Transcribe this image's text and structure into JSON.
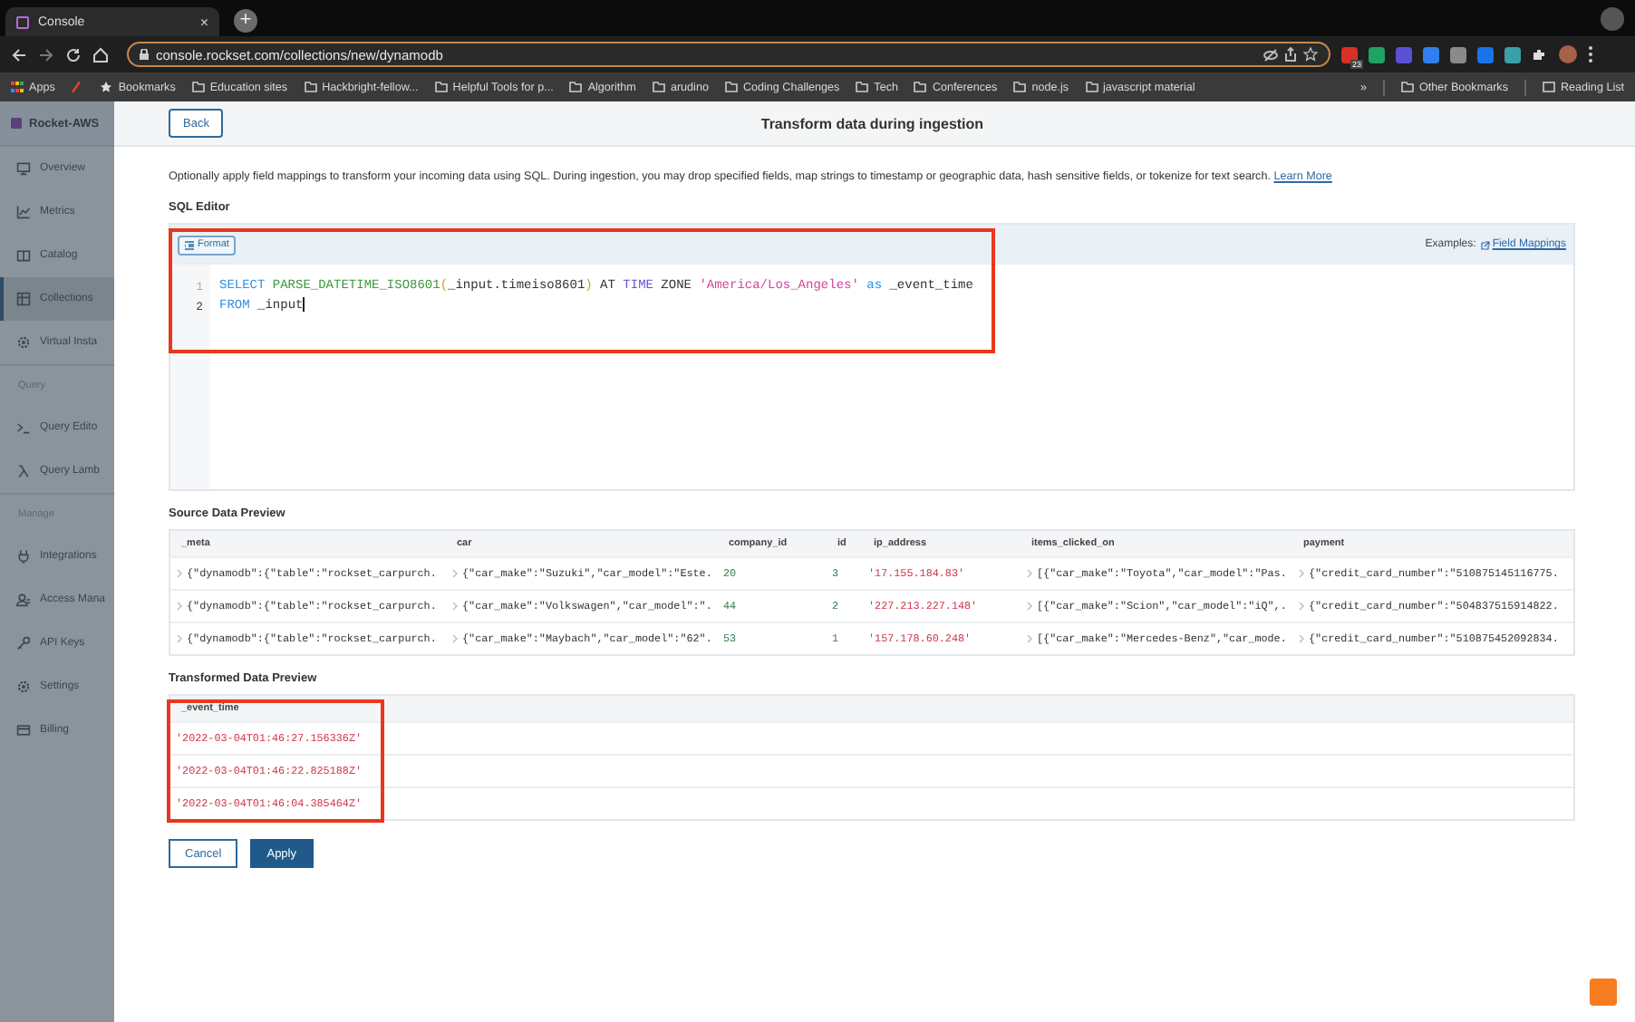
{
  "browser": {
    "tab": {
      "title": "Console",
      "close": "×",
      "selected": true
    },
    "new_tab": "+",
    "url": "console.rockset.com/collections/new/dynamodb",
    "extensions": [
      {
        "color": "#d93025",
        "badge": "23"
      },
      {
        "color": "#1ea362"
      },
      {
        "color": "#5b4fd6"
      },
      {
        "color": "#2f80ed"
      },
      {
        "color": "#8a8a8a"
      },
      {
        "color": "#1a73e8"
      },
      {
        "color": "#3aa0a8"
      }
    ],
    "bookmarks": [
      {
        "label": "Apps",
        "kind": "apps"
      },
      {
        "kind": "pencil"
      },
      {
        "label": "Bookmarks",
        "kind": "star"
      },
      {
        "label": "Education sites",
        "kind": "folder"
      },
      {
        "label": "Hackbright-fellow...",
        "kind": "folder"
      },
      {
        "label": "Helpful Tools for p...",
        "kind": "folder"
      },
      {
        "label": "Algorithm",
        "kind": "folder"
      },
      {
        "label": "arudino",
        "kind": "folder"
      },
      {
        "label": "Coding Challenges",
        "kind": "folder"
      },
      {
        "label": "Tech",
        "kind": "folder"
      },
      {
        "label": "Conferences",
        "kind": "folder"
      },
      {
        "label": "node.js",
        "kind": "folder"
      },
      {
        "label": "javascript material",
        "kind": "folder"
      }
    ],
    "more_bookmarks": "»",
    "other_bookmarks": "Other Bookmarks",
    "reading_list": "Reading List"
  },
  "sidebar": {
    "org": "Rocket-AWS",
    "items": [
      {
        "kind": "item",
        "label": "Overview",
        "selected": false
      },
      {
        "kind": "item",
        "label": "Metrics",
        "selected": false
      },
      {
        "kind": "item",
        "label": "Catalog",
        "selected": false
      },
      {
        "kind": "item",
        "label": "Collections",
        "selected": true
      },
      {
        "kind": "item",
        "label": "Virtual Insta",
        "selected": false
      },
      {
        "kind": "section",
        "label": "Query"
      },
      {
        "kind": "item",
        "label": "Query Edito",
        "selected": false
      },
      {
        "kind": "item",
        "label": "Query Lamb",
        "selected": false
      },
      {
        "kind": "section",
        "label": "Manage"
      },
      {
        "kind": "item",
        "label": "Integrations",
        "selected": false
      },
      {
        "kind": "item",
        "label": "Access Mana",
        "selected": false
      },
      {
        "kind": "item",
        "label": "API Keys",
        "selected": false
      },
      {
        "kind": "item",
        "label": "Settings",
        "selected": false
      },
      {
        "kind": "item",
        "label": "Billing",
        "selected": false
      }
    ]
  },
  "header": {
    "back": "Back",
    "title": "Transform data during ingestion"
  },
  "description": {
    "text": "Optionally apply field mappings to transform your incoming data using SQL. During ingestion, you may drop specified fields, map strings to timestamp or geographic data, hash sensitive fields, or tokenize for text search.",
    "link": "Learn More"
  },
  "sql_editor": {
    "label": "SQL Editor",
    "format_button": "Format",
    "examples_label": "Examples:",
    "examples_link": "Field Mappings",
    "highlighted": true,
    "lines": [
      {
        "number": "1",
        "active": false,
        "cursor": false,
        "tokens": [
          {
            "text": "SELECT ",
            "kind": "keyword"
          },
          {
            "text": "PARSE_DATETIME_ISO8601",
            "kind": "function"
          },
          {
            "text": "(",
            "kind": "punct"
          },
          {
            "text": "_input.timeiso8601",
            "kind": "plain"
          },
          {
            "text": ")",
            "kind": "punct"
          },
          {
            "text": " AT ",
            "kind": "plain"
          },
          {
            "text": "TIME",
            "kind": "type"
          },
          {
            "text": " ZONE ",
            "kind": "plain"
          },
          {
            "text": "'America/Los_Angeles'",
            "kind": "string"
          },
          {
            "text": " as",
            "kind": "keyword"
          },
          {
            "text": " _event_time",
            "kind": "plain"
          }
        ]
      },
      {
        "number": "2",
        "active": true,
        "cursor": true,
        "tokens": [
          {
            "text": "FROM",
            "kind": "keyword"
          },
          {
            "text": " _input",
            "kind": "plain"
          }
        ]
      }
    ]
  },
  "source_preview": {
    "label": "Source Data Preview",
    "columns": [
      {
        "label": "_meta",
        "kind": "json"
      },
      {
        "label": "car",
        "kind": "json"
      },
      {
        "label": "company_id",
        "kind": "number"
      },
      {
        "label": "id",
        "kind": "number"
      },
      {
        "label": "ip_address",
        "kind": "string"
      },
      {
        "label": "items_clicked_on",
        "kind": "json"
      },
      {
        "label": "payment",
        "kind": "json"
      }
    ],
    "rows": [
      [
        "{\"dynamodb\":{\"table\":\"rockset_carpurch.",
        "{\"car_make\":\"Suzuki\",\"car_model\":\"Este.",
        "20",
        "3",
        "'17.155.184.83'",
        "[{\"car_make\":\"Toyota\",\"car_model\":\"Pas.",
        "{\"credit_card_number\":\"510875145116775."
      ],
      [
        "{\"dynamodb\":{\"table\":\"rockset_carpurch.",
        "{\"car_make\":\"Volkswagen\",\"car_model\":\".",
        "44",
        "2",
        "'227.213.227.148'",
        "[{\"car_make\":\"Scion\",\"car_model\":\"iQ\",.",
        "{\"credit_card_number\":\"504837515914822."
      ],
      [
        "{\"dynamodb\":{\"table\":\"rockset_carpurch.",
        "{\"car_make\":\"Maybach\",\"car_model\":\"62\".",
        "53",
        "1",
        "'157.178.60.248'",
        "[{\"car_make\":\"Mercedes-Benz\",\"car_mode.",
        "{\"credit_card_number\":\"510875452092834."
      ]
    ]
  },
  "transformed_preview": {
    "label": "Transformed Data Preview",
    "highlighted": true,
    "column": "_event_time",
    "rows": [
      "'2022-03-04T01:46:27.156336Z'",
      "'2022-03-04T01:46:22.825188Z'",
      "'2022-03-04T01:46:04.385464Z'"
    ]
  },
  "actions": {
    "cancel": "Cancel",
    "apply": "Apply"
  }
}
